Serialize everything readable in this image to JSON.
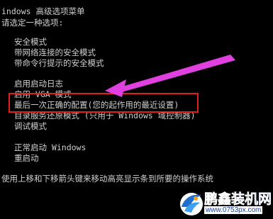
{
  "screen": {
    "title": "indows 高级选项菜单",
    "prompt": "请选定一种选项:"
  },
  "menu": {
    "items": [
      {
        "label": "安全模式"
      },
      {
        "label": "带网络连接的安全模式"
      },
      {
        "label": "带命令行提示的安全模式"
      },
      {
        "label": "启用启动日志"
      },
      {
        "label": "启用 VGA 模式"
      },
      {
        "label": "最后一次正确的配置(您的起作用的最近设置)"
      },
      {
        "label": "目录服务还原模式 (只用于 Windows 域控制器)"
      },
      {
        "label": "调试模式"
      },
      {
        "label": "正常启动 Windows"
      },
      {
        "label": "重启动"
      }
    ],
    "selected_index": 5
  },
  "footer": {
    "hint": "使用上移和下移箭头键来移动高亮显示条到所要的操作系统"
  },
  "annotation": {
    "highlight_color": "#e02020",
    "arrow_color": "#e040e0"
  },
  "watermark": {
    "title": "鹏鑫装机网",
    "url": "www.0753px.com"
  }
}
